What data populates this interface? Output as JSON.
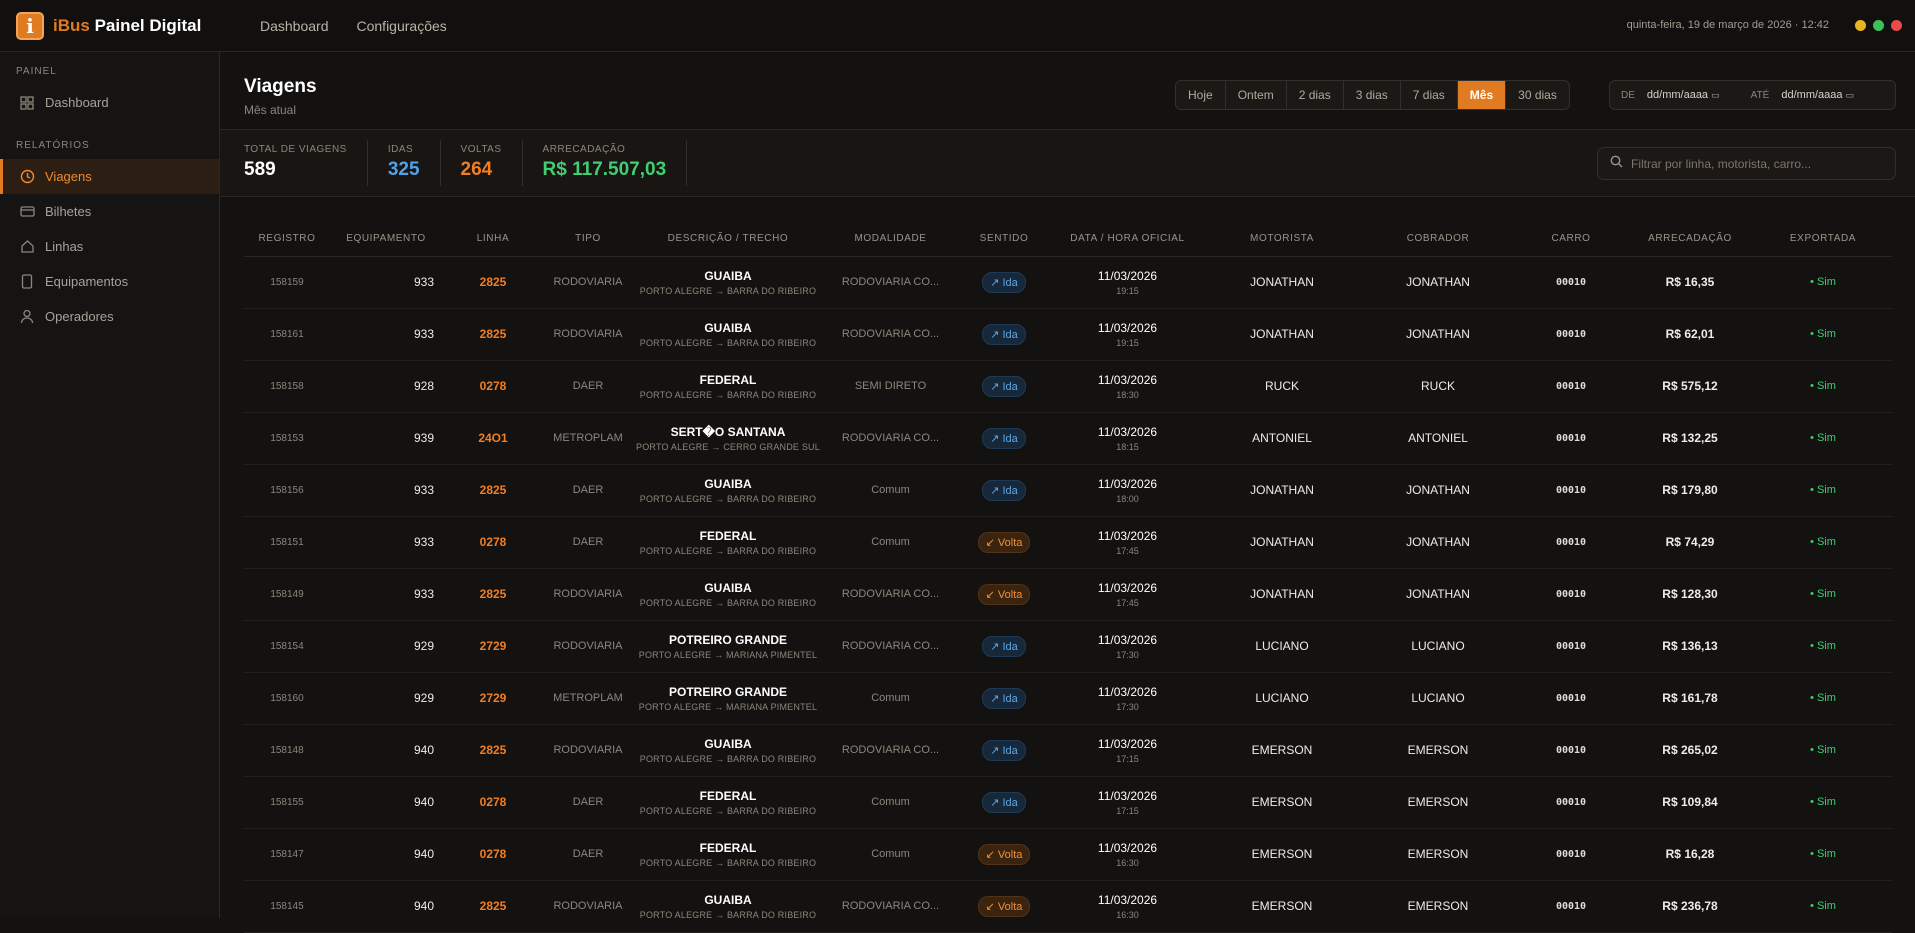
{
  "topbar": {
    "brand_prefix": "iBus",
    "brand_suffix": "Painel Digital",
    "logo_letter": "i",
    "nav": [
      "Dashboard",
      "Configurações"
    ],
    "datetime": "quinta-feira, 19 de março de 2026 · 12:42"
  },
  "sidebar": {
    "section1": "PAINEL",
    "section2": "RELATÓRIOS",
    "items1": [
      {
        "label": "Dashboard",
        "icon": "grid-icon"
      }
    ],
    "items2": [
      {
        "label": "Viagens",
        "icon": "clock-icon",
        "active": true
      },
      {
        "label": "Bilhetes",
        "icon": "card-icon"
      },
      {
        "label": "Linhas",
        "icon": "home-icon"
      },
      {
        "label": "Equipamentos",
        "icon": "device-icon"
      },
      {
        "label": "Operadores",
        "icon": "user-icon"
      }
    ]
  },
  "header": {
    "title": "Viagens",
    "subtitle": "Mês atual",
    "ranges": [
      "Hoje",
      "Ontem",
      "2 dias",
      "3 dias",
      "7 dias",
      "Mês",
      "30 dias"
    ],
    "active_range": "Mês",
    "date_from_label": "DE",
    "date_from_value": "dd/mm/aaaa",
    "date_to_label": "ATÉ",
    "date_to_value": "dd/mm/aaaa"
  },
  "stats": [
    {
      "label": "TOTAL DE VIAGENS",
      "value": "589",
      "color": "#ffffff"
    },
    {
      "label": "IDAS",
      "value": "325",
      "color": "#4ea3ea"
    },
    {
      "label": "VOLTAS",
      "value": "264",
      "color": "#f07e25"
    },
    {
      "label": "ARRECADAÇÃO",
      "value": "R$ 117.507,03",
      "color": "#3fcf72"
    }
  ],
  "search": {
    "placeholder": "Filtrar por linha, motorista, carro..."
  },
  "table": {
    "columns": [
      "REGISTRO",
      "EQUIPAMENTO",
      "LINHA",
      "TIPO",
      "DESCRIÇÃO / TRECHO",
      "MODALIDADE",
      "SENTIDO",
      "DATA / HORA OFICIAL",
      "MOTORISTA",
      "COBRADOR",
      "CARRO",
      "ARRECADAÇÃO",
      "EXPORTADA"
    ],
    "rows": [
      {
        "reg": "158159",
        "eq": "933",
        "linha": "2825",
        "tipo": "RODOVIARIA",
        "desc": "GUAIBA",
        "trecho": "PORTO ALEGRE → BARRA DO RIBEIRO",
        "mod": "RODOVIARIA CO...",
        "sentido": "↗ Ida",
        "data": "11/03/2026",
        "hora": "19:15",
        "mot": "JONATHAN",
        "cob": "JONATHAN",
        "carro": "00010",
        "arr": "R$ 16,35",
        "exp": "• Sim"
      },
      {
        "reg": "158161",
        "eq": "933",
        "linha": "2825",
        "tipo": "RODOVIARIA",
        "desc": "GUAIBA",
        "trecho": "PORTO ALEGRE → BARRA DO RIBEIRO",
        "mod": "RODOVIARIA CO...",
        "sentido": "↗ Ida",
        "data": "11/03/2026",
        "hora": "19:15",
        "mot": "JONATHAN",
        "cob": "JONATHAN",
        "carro": "00010",
        "arr": "R$ 62,01",
        "exp": "• Sim"
      },
      {
        "reg": "158158",
        "eq": "928",
        "linha": "0278",
        "tipo": "DAER",
        "desc": "FEDERAL",
        "trecho": "PORTO ALEGRE → BARRA DO RIBEIRO",
        "mod": "SEMI DIRETO",
        "sentido": "↗ Ida",
        "data": "11/03/2026",
        "hora": "18:30",
        "mot": "RUCK",
        "cob": "RUCK",
        "carro": "00010",
        "arr": "R$ 575,12",
        "exp": "• Sim"
      },
      {
        "reg": "158153",
        "eq": "939",
        "linha": "24O1",
        "tipo": "METROPLAM",
        "desc": "SERT�O SANTANA",
        "trecho": "PORTO ALEGRE → CERRO GRANDE SUL",
        "mod": "RODOVIARIA CO...",
        "sentido": "↗ Ida",
        "data": "11/03/2026",
        "hora": "18:15",
        "mot": "ANTONIEL",
        "cob": "ANTONIEL",
        "carro": "00010",
        "arr": "R$ 132,25",
        "exp": "• Sim"
      },
      {
        "reg": "158156",
        "eq": "933",
        "linha": "2825",
        "tipo": "DAER",
        "desc": "GUAIBA",
        "trecho": "PORTO ALEGRE → BARRA DO RIBEIRO",
        "mod": "Comum",
        "sentido": "↗ Ida",
        "data": "11/03/2026",
        "hora": "18:00",
        "mot": "JONATHAN",
        "cob": "JONATHAN",
        "carro": "00010",
        "arr": "R$ 179,80",
        "exp": "• Sim"
      },
      {
        "reg": "158151",
        "eq": "933",
        "linha": "0278",
        "tipo": "DAER",
        "desc": "FEDERAL",
        "trecho": "PORTO ALEGRE → BARRA DO RIBEIRO",
        "mod": "Comum",
        "sentido": "↙ Volta",
        "data": "11/03/2026",
        "hora": "17:45",
        "mot": "JONATHAN",
        "cob": "JONATHAN",
        "carro": "00010",
        "arr": "R$ 74,29",
        "exp": "• Sim"
      },
      {
        "reg": "158149",
        "eq": "933",
        "linha": "2825",
        "tipo": "RODOVIARIA",
        "desc": "GUAIBA",
        "trecho": "PORTO ALEGRE → BARRA DO RIBEIRO",
        "mod": "RODOVIARIA CO...",
        "sentido": "↙ Volta",
        "data": "11/03/2026",
        "hora": "17:45",
        "mot": "JONATHAN",
        "cob": "JONATHAN",
        "carro": "00010",
        "arr": "R$ 128,30",
        "exp": "• Sim"
      },
      {
        "reg": "158154",
        "eq": "929",
        "linha": "2729",
        "tipo": "RODOVIARIA",
        "desc": "POTREIRO GRANDE",
        "trecho": "PORTO ALEGRE → MARIANA PIMENTEL",
        "mod": "RODOVIARIA CO...",
        "sentido": "↗ Ida",
        "data": "11/03/2026",
        "hora": "17:30",
        "mot": "LUCIANO",
        "cob": "LUCIANO",
        "carro": "00010",
        "arr": "R$ 136,13",
        "exp": "• Sim"
      },
      {
        "reg": "158160",
        "eq": "929",
        "linha": "2729",
        "tipo": "METROPLAM",
        "desc": "POTREIRO GRANDE",
        "trecho": "PORTO ALEGRE → MARIANA PIMENTEL",
        "mod": "Comum",
        "sentido": "↗ Ida",
        "data": "11/03/2026",
        "hora": "17:30",
        "mot": "LUCIANO",
        "cob": "LUCIANO",
        "carro": "00010",
        "arr": "R$ 161,78",
        "exp": "• Sim"
      },
      {
        "reg": "158148",
        "eq": "940",
        "linha": "2825",
        "tipo": "RODOVIARIA",
        "desc": "GUAIBA",
        "trecho": "PORTO ALEGRE → BARRA DO RIBEIRO",
        "mod": "RODOVIARIA CO...",
        "sentido": "↗ Ida",
        "data": "11/03/2026",
        "hora": "17:15",
        "mot": "EMERSON",
        "cob": "EMERSON",
        "carro": "00010",
        "arr": "R$ 265,02",
        "exp": "• Sim"
      },
      {
        "reg": "158155",
        "eq": "940",
        "linha": "0278",
        "tipo": "DAER",
        "desc": "FEDERAL",
        "trecho": "PORTO ALEGRE → BARRA DO RIBEIRO",
        "mod": "Comum",
        "sentido": "↗ Ida",
        "data": "11/03/2026",
        "hora": "17:15",
        "mot": "EMERSON",
        "cob": "EMERSON",
        "carro": "00010",
        "arr": "R$ 109,84",
        "exp": "• Sim"
      },
      {
        "reg": "158147",
        "eq": "940",
        "linha": "0278",
        "tipo": "DAER",
        "desc": "FEDERAL",
        "trecho": "PORTO ALEGRE → BARRA DO RIBEIRO",
        "mod": "Comum",
        "sentido": "↙ Volta",
        "data": "11/03/2026",
        "hora": "16:30",
        "mot": "EMERSON",
        "cob": "EMERSON",
        "carro": "00010",
        "arr": "R$ 16,28",
        "exp": "• Sim"
      },
      {
        "reg": "158145",
        "eq": "940",
        "linha": "2825",
        "tipo": "RODOVIARIA",
        "desc": "GUAIBA",
        "trecho": "PORTO ALEGRE → BARRA DO RIBEIRO",
        "mod": "RODOVIARIA CO...",
        "sentido": "↙ Volta",
        "data": "11/03/2026",
        "hora": "16:30",
        "mot": "EMERSON",
        "cob": "EMERSON",
        "carro": "00010",
        "arr": "R$ 236,78",
        "exp": "• Sim"
      }
    ]
  },
  "colors": {
    "accent": "#e07b22",
    "ida": "#5fa7e6",
    "volta": "#f0913b",
    "exported": "#3fcf72",
    "window_dots": [
      "#e8b527",
      "#3fbf5a",
      "#e94a4a"
    ]
  }
}
